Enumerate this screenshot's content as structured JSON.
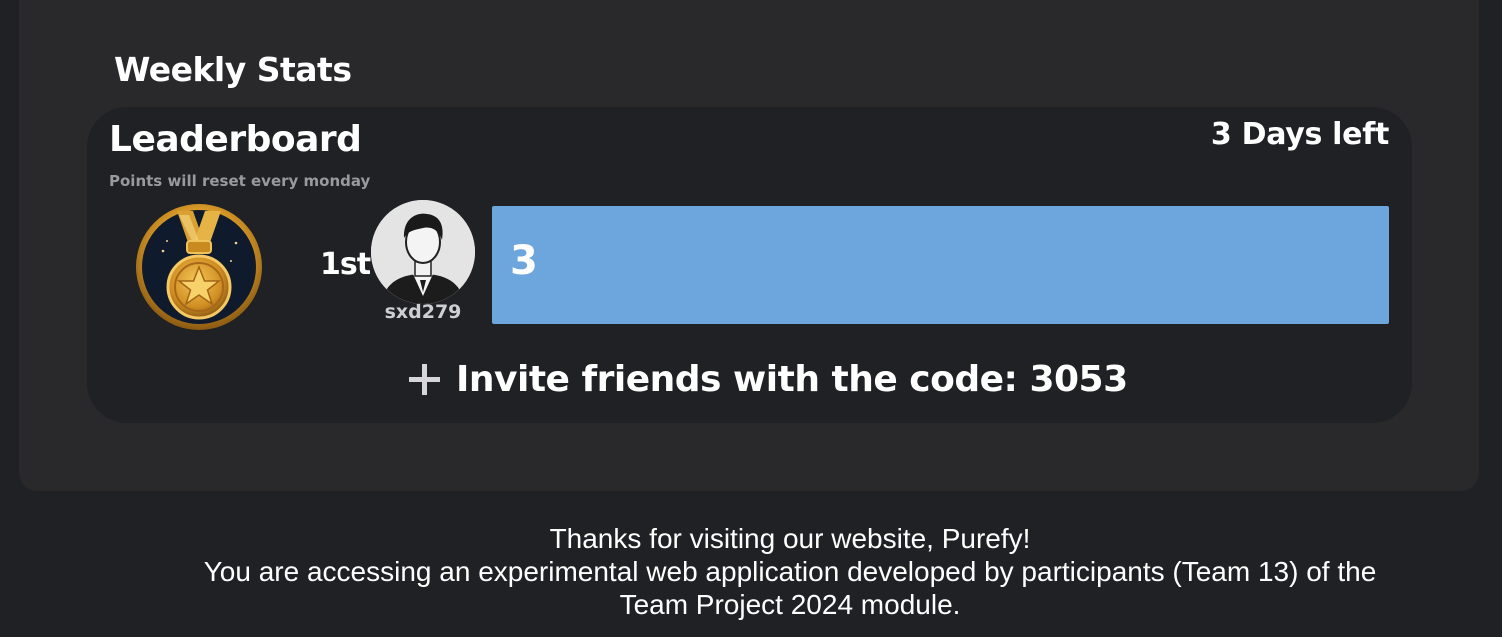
{
  "weekly_stats": {
    "title": "Weekly Stats"
  },
  "leaderboard": {
    "title": "Leaderboard",
    "subtitle": "Points will reset every monday",
    "days_left": "3 Days left",
    "entries": [
      {
        "rank": "1st",
        "username": "sxd279",
        "points": "3",
        "medal": "gold-medal-icon",
        "avatar": "user-avatar-icon"
      }
    ],
    "bar_color": "#6ca6dc",
    "invite_icon": "plus-icon",
    "invite_text": "Invite friends with the code: 3053"
  },
  "footer": {
    "line1": "Thanks for visiting our website, Purefy!",
    "line2": "You are accessing an experimental web application developed by participants (Team 13) of the",
    "line3": "Team Project 2024 module."
  }
}
